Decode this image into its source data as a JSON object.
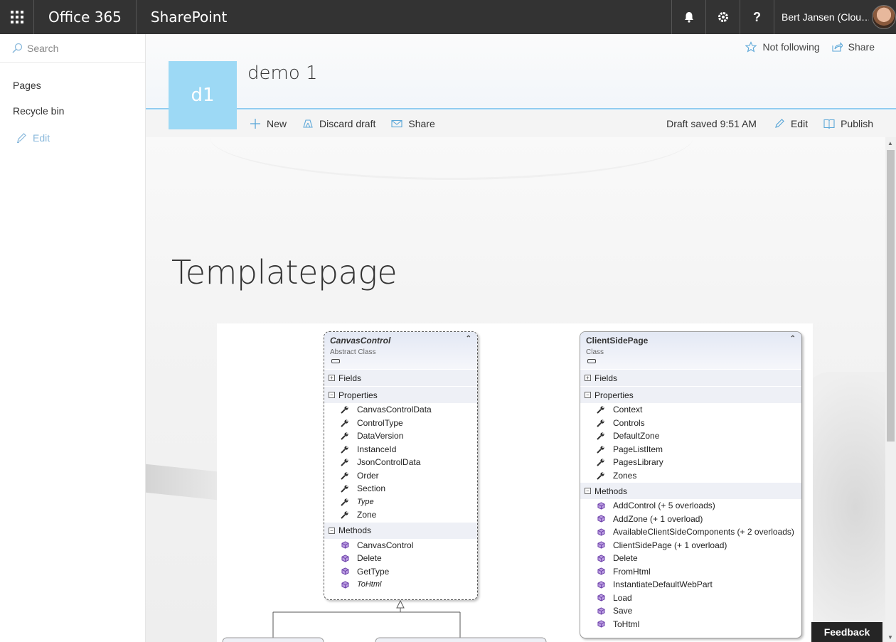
{
  "suitebar": {
    "brand": "Office 365",
    "app": "SharePoint",
    "user_name": "Bert Jansen (Clou…",
    "help_label": "?"
  },
  "leftnav": {
    "search_placeholder": "Search",
    "items": [
      {
        "label": "Pages"
      },
      {
        "label": "Recycle bin"
      }
    ],
    "edit_label": "Edit"
  },
  "header": {
    "site_logo_text": "d1",
    "site_title": "demo 1",
    "follow_label": "Not following",
    "share_label": "Share"
  },
  "commandbar": {
    "new_label": "New",
    "discard_label": "Discard draft",
    "share_label": "Share",
    "draft_status": "Draft saved 9:51 AM",
    "edit_label": "Edit",
    "publish_label": "Publish"
  },
  "page": {
    "title": "Templatepage"
  },
  "diagram": {
    "canvascontrol": {
      "name": "CanvasControl",
      "kind": "Abstract Class",
      "fields_label": "Fields",
      "properties_label": "Properties",
      "properties": [
        "CanvasControlData",
        "ControlType",
        "DataVersion",
        "InstanceId",
        "JsonControlData",
        "Order",
        "Section",
        "Type",
        "Zone"
      ],
      "methods_label": "Methods",
      "methods": [
        "CanvasControl",
        "Delete",
        "GetType",
        "ToHtml"
      ]
    },
    "clientsidepage": {
      "name": "ClientSidePage",
      "kind": "Class",
      "fields_label": "Fields",
      "properties_label": "Properties",
      "properties": [
        "Context",
        "Controls",
        "DefaultZone",
        "PageListItem",
        "PagesLibrary",
        "Zones"
      ],
      "methods_label": "Methods",
      "methods": [
        "AddControl (+ 5 overloads)",
        "AddZone (+ 1 overload)",
        "AvailableClientSideComponents (+ 2 overloads)",
        "ClientSidePage (+ 1 overload)",
        "Delete",
        "FromHtml",
        "InstantiateDefaultWebPart",
        "Load",
        "Save",
        "ToHtml"
      ]
    }
  },
  "feedback_label": "Feedback",
  "colors": {
    "suitebar": "#333333",
    "accent": "#8fcbf0",
    "site_logo": "#9dd9f5"
  }
}
